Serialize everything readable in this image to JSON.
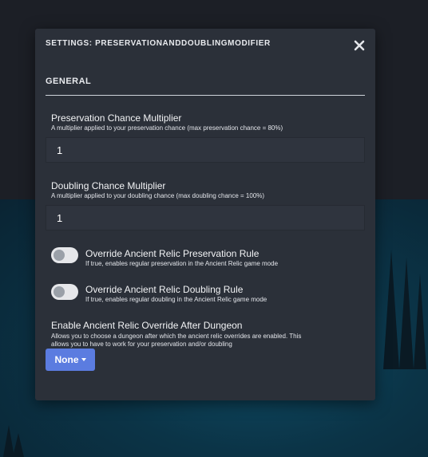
{
  "modal": {
    "title": "SETTINGS: PRESERVATIONANDDOUBLINGMODIFIER",
    "close_icon": "close-icon",
    "section_title": "GENERAL"
  },
  "fields": {
    "preservation": {
      "label": "Preservation Chance Multiplier",
      "description": "A multiplier applied to your preservation chance (max preservation chance = 80%)",
      "value": "1"
    },
    "doubling": {
      "label": "Doubling Chance Multiplier",
      "description": "A multiplier applied to your doubling chance (max doubling chance = 100%)",
      "value": "1"
    }
  },
  "toggles": {
    "preservation_rule": {
      "label": "Override Ancient Relic Preservation Rule",
      "description": "If true, enables regular preservation in the Ancient Relic game mode",
      "checked": false
    },
    "doubling_rule": {
      "label": "Override Ancient Relic Doubling Rule",
      "description": "If true, enables regular doubling in the Ancient Relic game mode",
      "checked": false
    }
  },
  "dungeon_override": {
    "label": "Enable Ancient Relic Override After Dungeon",
    "description_line1": "Allows you to choose a dungeon after which the ancient relic overrides are enabled. This",
    "description_line2": "allows you to have to work for your preservation and/or doubling",
    "selected": "None"
  },
  "colors": {
    "modal_bg": "#2b3039",
    "accent": "#5b7ce0"
  }
}
